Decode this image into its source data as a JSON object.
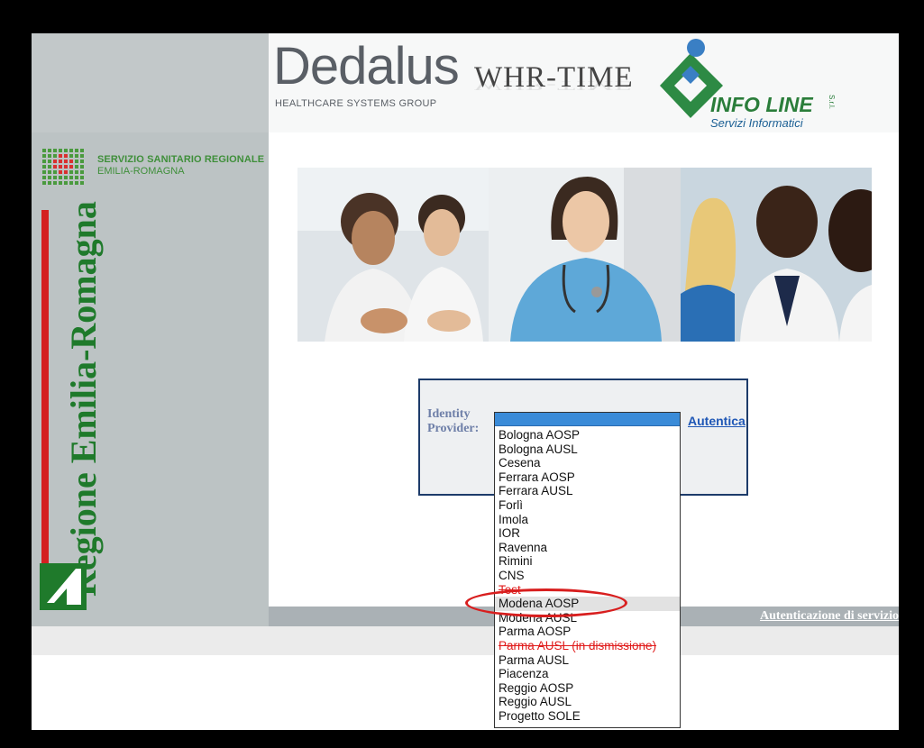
{
  "header": {
    "dedalus_logo": "Dedalus",
    "dedalus_sub": "HEALTHCARE SYSTEMS GROUP",
    "product": "WHR-TIME",
    "infoline_name": "INFO LINE",
    "infoline_srl": "S.r.l.",
    "infoline_sub": "Servizi Informatici"
  },
  "sidebar": {
    "ssr_line1": "SERVIZIO SANITARIO REGIONALE",
    "ssr_line2": "EMILIA-ROMAGNA",
    "region_name": "Regione Emilia-Romagna"
  },
  "login": {
    "idp_label": "Identity Provider:",
    "auth_link": "Autentica"
  },
  "dropdown": {
    "options": [
      {
        "label": "Bologna AOSP"
      },
      {
        "label": "Bologna AUSL"
      },
      {
        "label": "Cesena"
      },
      {
        "label": "Ferrara AOSP"
      },
      {
        "label": "Ferrara AUSL"
      },
      {
        "label": "Forlì"
      },
      {
        "label": "Imola"
      },
      {
        "label": "IOR"
      },
      {
        "label": "Ravenna"
      },
      {
        "label": "Rimini"
      },
      {
        "label": "CNS"
      },
      {
        "label": "Test",
        "style": "red"
      },
      {
        "label": "Modena AOSP",
        "style": "hl"
      },
      {
        "label": "Modena AUSL"
      },
      {
        "label": "Parma AOSP"
      },
      {
        "label": "Parma AUSL (in dismissione)",
        "style": "red"
      },
      {
        "label": "Parma AUSL"
      },
      {
        "label": "Piacenza"
      },
      {
        "label": "Reggio AOSP"
      },
      {
        "label": "Reggio AUSL"
      },
      {
        "label": "Progetto SOLE"
      }
    ]
  },
  "footer": {
    "link": "Autenticazione di servizio"
  },
  "colors": {
    "accent_green": "#1f7a2b",
    "link_blue": "#1f57b6",
    "select_blue": "#3a8bd8",
    "annotation_red": "#d81e1e"
  }
}
